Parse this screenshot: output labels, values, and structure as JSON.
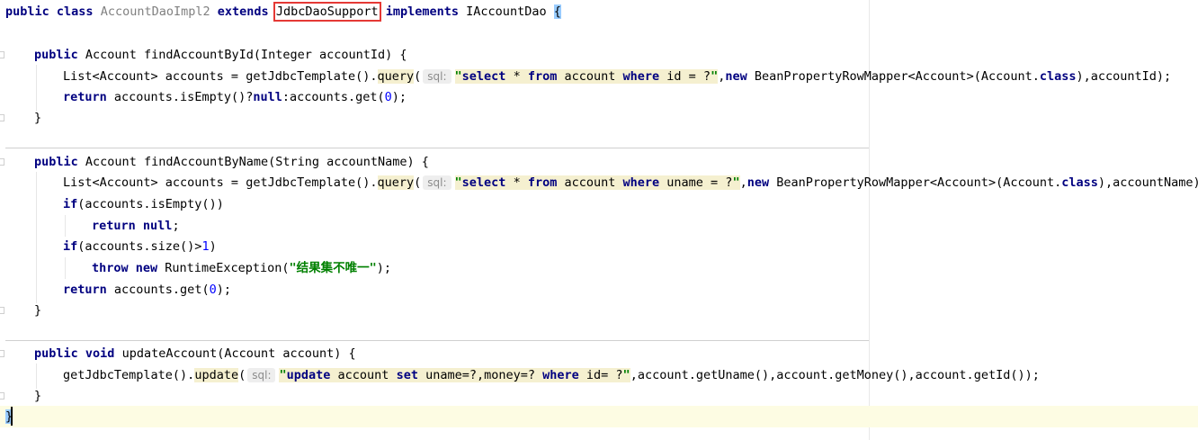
{
  "code": {
    "class_decl": {
      "kw1": "public",
      "kw2": "class",
      "name": "AccountDaoImpl2",
      "kw3": "extends",
      "super": "JdbcDaoSupport",
      "kw4": "implements",
      "iface": "IAccountDao",
      "brace": "{"
    },
    "m1": {
      "sig": "Account findAccountById(Integer accountId) {",
      "l1_pre": "List<Account> accounts = getJdbcTemplate().",
      "l1_call": "query",
      "l1_paren": "(",
      "hint": "sql:",
      "sql_q1": "\"",
      "sql_select": "select",
      "sql_star": " * ",
      "sql_from": "from",
      "sql_tbl": " account ",
      "sql_where": "where",
      "sql_rest": " id = ?",
      "sql_q2": "\"",
      "l1_comma": ",",
      "l1_new": "new",
      "l1_mapper": " BeanPropertyRowMapper<Account>(Account.",
      "l1_class": "class",
      "l1_end": "),accountId);",
      "l2_return": "return",
      "l2_a": " accounts.isEmpty()?",
      "l2_null": "null",
      "l2_b": ":accounts.get(",
      "l2_zero": "0",
      "l2_c": ");",
      "close": "}"
    },
    "m2": {
      "sig": "Account findAccountByName(String accountName) {",
      "l1_pre": "List<Account> accounts = getJdbcTemplate().",
      "l1_call": "query",
      "sql_rest": " uname = ?",
      "l1_end": "),accountName);",
      "if1_a": "(accounts.isEmpty())",
      "ret_null_end": ";",
      "if2_a": "(accounts.size()>",
      "if2_one": "1",
      "if2_b": ")",
      "throw": "throw",
      "throw_cls": " RuntimeException(",
      "throw_msg": "\"结果集不唯一\"",
      "throw_end": ");",
      "ret2_a": " accounts.get(",
      "ret2_end": ");",
      "close": "}"
    },
    "m3": {
      "kw_void": "void",
      "sig": "updateAccount(Account account) {",
      "l1_pre": "getJdbcTemplate().",
      "l1_call": "update",
      "sql_update": "update",
      "sql_tbl": " account ",
      "sql_set": "set",
      "sql_mid": " uname=?,money=? ",
      "sql_where": "where",
      "sql_rest": " id= ?",
      "l1_end": ",account.getUname(),account.getMoney(),account.getId());",
      "close": "}"
    },
    "kw": {
      "public": "public",
      "if": "if",
      "return": "return",
      "null": "null",
      "new": "new"
    },
    "class_close": "}"
  }
}
